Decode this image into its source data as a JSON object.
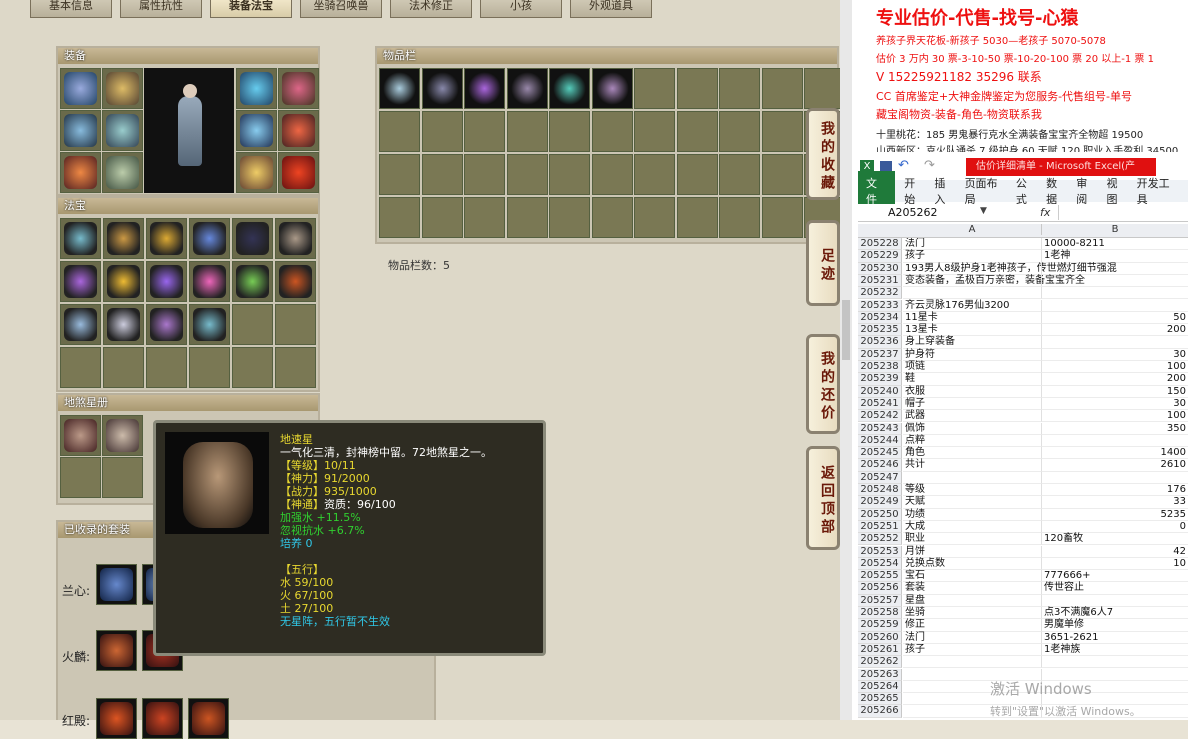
{
  "tabs": [
    "基本信息",
    "属性抗性",
    "装备法宝",
    "坐骑召唤兽",
    "法术修正",
    "小孩",
    "外观道具"
  ],
  "panels": {
    "equipment": "装备",
    "fabao": "法宝",
    "inventory": "物品栏",
    "dishaxing": "地煞星册",
    "suits": "已收录的套装"
  },
  "inventory_count": "物品栏数：5",
  "side_buttons": [
    "我的收藏",
    "足迹",
    "我的还价",
    "返回顶部"
  ],
  "suits": [
    {
      "label": "兰心:"
    },
    {
      "label": "火麟:"
    },
    {
      "label": "红殿:"
    }
  ],
  "tooltip": {
    "name": "地速星",
    "desc": "一气化三清，封神榜中留。72地煞星之一。",
    "level": "【等级】10/11",
    "shenli": "【神力】91/2000",
    "zhanli": "【战力】935/1000",
    "shentong_label": "【神通】",
    "shentong_value": "资质：96/100",
    "buff1": "加强水 +11.5%",
    "buff2": "忽视抗水 +6.7%",
    "peiyang": "培养 0",
    "wuxing": "【五行】",
    "water": "水 59/100",
    "fire": "火 67/100",
    "earth": "土 27/100",
    "note": "无星阵，五行暂不生效"
  },
  "ads": [
    "专业估价-代售-找号-心猿",
    "养孩子界天花板-新孩子 5030—老孩子 5070-5078",
    "估价 3 万内 30 票-3-10-50 票-10-20-100 票 20 以上-1 票 1",
    "V 15225921182         35296    联系",
    "CC 首席鉴定+大神金牌鉴定为您服务-代售组号-单号",
    "藏宝阁物资-装备-角色-物资联系我",
    "十里桃花：185 男鬼暴行克水全满装备宝宝齐全物超 19500",
    "山西新区：克火队通杀 7 级护身 60 天赋 120 职业入手盈利 34500"
  ],
  "excel": {
    "title": "估价详细清单 - Microsoft Excel(产",
    "ribbon": [
      "文件",
      "开始",
      "插入",
      "页面布局",
      "公式",
      "数据",
      "审阅",
      "视图",
      "开发工具"
    ],
    "name_box": "A205262",
    "fx": "fx",
    "col_a": "A",
    "col_b": "B",
    "rows": [
      [
        "205228",
        "法门",
        "10000-8211"
      ],
      [
        "205229",
        "孩子",
        "1老神"
      ],
      [
        "205230",
        "193男人8级护身1老神孩子，传世燃灯细节强混",
        ""
      ],
      [
        "205231",
        "变态装备，孟极百万亲密，装备宝宝齐全",
        ""
      ],
      [
        "205232",
        "",
        ""
      ],
      [
        "205233",
        "齐云灵脉176男仙3200",
        ""
      ],
      [
        "205234",
        "11星卡",
        "50"
      ],
      [
        "205235",
        "13星卡",
        "200"
      ],
      [
        "205236",
        "身上穿装备",
        ""
      ],
      [
        "205237",
        "护身符",
        "30"
      ],
      [
        "205238",
        "项链",
        "100"
      ],
      [
        "205239",
        "鞋",
        "200"
      ],
      [
        "205240",
        "衣服",
        "150"
      ],
      [
        "205241",
        "帽子",
        "30"
      ],
      [
        "205242",
        "武器",
        "100"
      ],
      [
        "205243",
        "佩饰",
        "350"
      ],
      [
        "205244",
        "点粹",
        ""
      ],
      [
        "205245",
        "角色",
        "1400"
      ],
      [
        "205246",
        "共计",
        "2610"
      ],
      [
        "205247",
        "",
        ""
      ],
      [
        "205248",
        "等级",
        "176"
      ],
      [
        "205249",
        "天赋",
        "33"
      ],
      [
        "205250",
        "功绩",
        "5235"
      ],
      [
        "205251",
        "大成",
        "0"
      ],
      [
        "205252",
        "职业",
        "120畜牧"
      ],
      [
        "205253",
        "月饼",
        "42"
      ],
      [
        "205254",
        "兑换点数",
        "10"
      ],
      [
        "205255",
        "宝石",
        "777666+"
      ],
      [
        "205256",
        "套装",
        "传世容止"
      ],
      [
        "205257",
        "星盘",
        ""
      ],
      [
        "205258",
        "坐骑",
        "点3不满魔6人7"
      ],
      [
        "205259",
        "修正",
        "男魔单修"
      ],
      [
        "205260",
        "法门",
        "3651-2621"
      ],
      [
        "205261",
        "孩子",
        "1老神族"
      ],
      [
        "205262",
        "",
        ""
      ],
      [
        "205263",
        "",
        ""
      ],
      [
        "205264",
        "",
        ""
      ],
      [
        "205265",
        "",
        ""
      ],
      [
        "205266",
        "",
        ""
      ]
    ]
  },
  "watermark": {
    "line1": "激活 Windows",
    "line2": "转到\"设置\"以激活 Windows。"
  }
}
